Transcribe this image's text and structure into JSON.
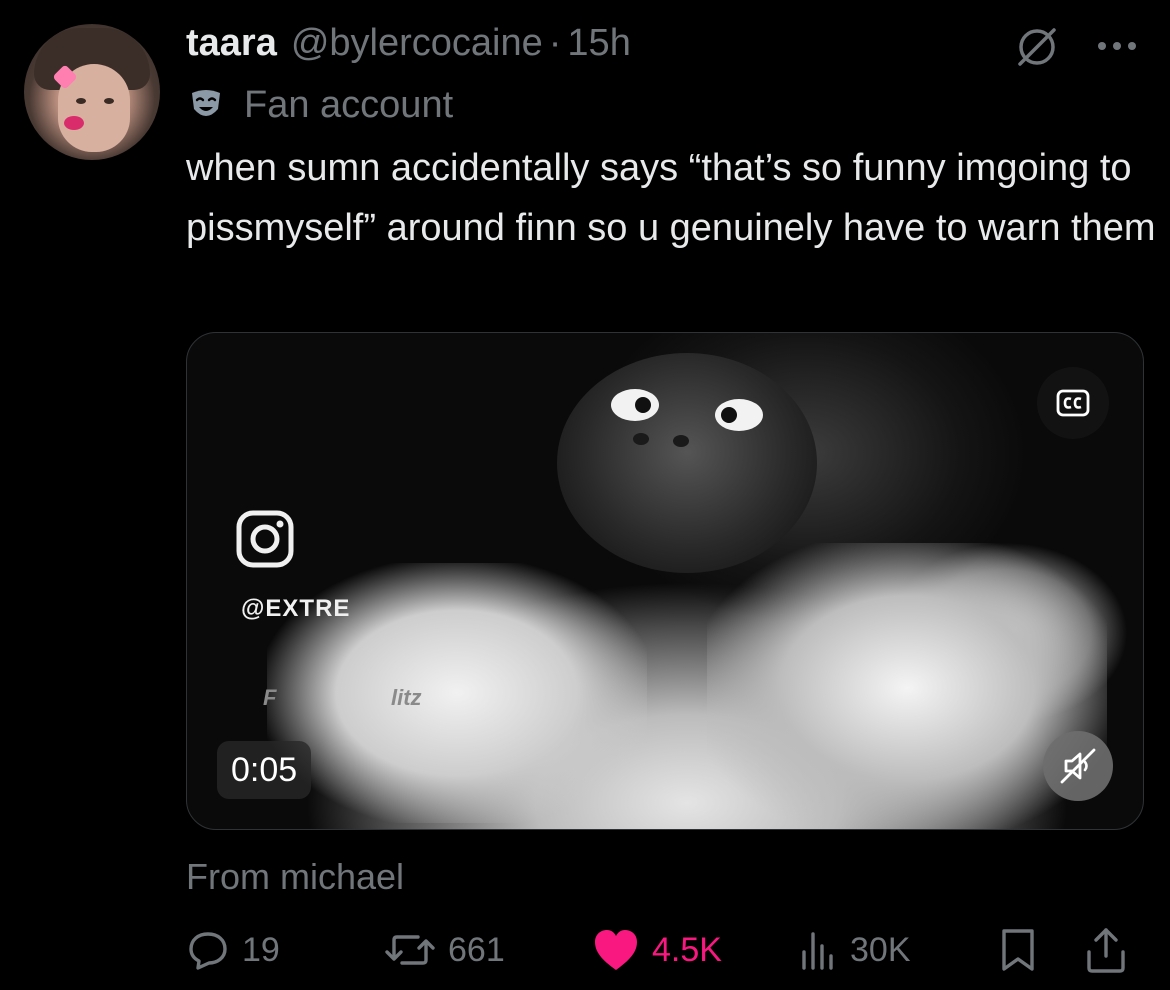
{
  "author": {
    "display_name": "taara",
    "handle": "@bylercocaine",
    "separator": "·",
    "time": "15h",
    "label": "Fan account"
  },
  "tweet": {
    "text": "when sumn accidentally says “that’s so funny imgoing to pissmyself” around finn so u genuinely have to warn them"
  },
  "media": {
    "duration": "0:05",
    "watermark_handle": "@EXTRE",
    "watermark_sub_a": "F",
    "watermark_sub_b": "litz",
    "cc_icon": "closed-captions-icon",
    "mute_icon": "muted-speaker-icon"
  },
  "attribution": {
    "text": "From michael"
  },
  "actions": {
    "reply_count": "19",
    "repost_count": "661",
    "like_count": "4.5K",
    "views_count": "30K"
  },
  "colors": {
    "background": "#000000",
    "primary_text": "#e7e9ea",
    "secondary_text": "#71767b",
    "like_pink": "#f91880"
  }
}
